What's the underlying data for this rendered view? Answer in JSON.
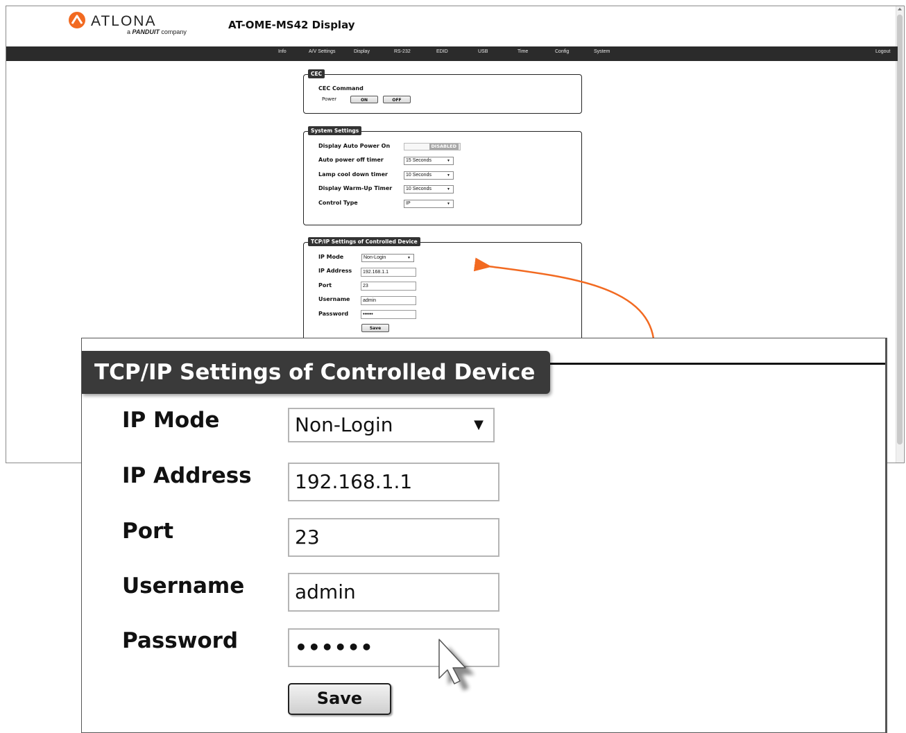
{
  "brand": {
    "name": "ATLONA",
    "tagline_prefix": "a",
    "tagline_brand": "PANDUIT",
    "tagline_suffix": "company"
  },
  "page_title": "AT-OME-MS42  Display",
  "nav": {
    "items": [
      "Info",
      "A/V Settings",
      "Display",
      "RS-232",
      "EDID",
      "USB",
      "Time",
      "Config",
      "System"
    ],
    "logout": "Logout"
  },
  "cec": {
    "legend": "CEC",
    "command_label": "CEC Command",
    "power_label": "Power",
    "on_label": "ON",
    "off_label": "OFF"
  },
  "system_settings": {
    "legend": "System Settings",
    "auto_power_on_label": "Display Auto Power On",
    "auto_power_on_state": "DISABLED",
    "auto_power_off_label": "Auto power off timer",
    "auto_power_off_value": "15 Seconds",
    "lamp_cool_label": "Lamp cool down timer",
    "lamp_cool_value": "10 Seconds",
    "warmup_label": "Display Warm-Up Timer",
    "warmup_value": "10 Seconds",
    "control_type_label": "Control Type",
    "control_type_value": "IP"
  },
  "tcpip": {
    "legend": "TCP/IP Settings of Controlled Device",
    "ip_mode_label": "IP Mode",
    "ip_mode_value": "Non-Login",
    "ip_address_label": "IP Address",
    "ip_address_value": "192.168.1.1",
    "port_label": "Port",
    "port_value": "23",
    "username_label": "Username",
    "username_value": "admin",
    "password_label": "Password",
    "password_value": "••••••",
    "save_label": "Save"
  },
  "colors": {
    "accent": "#f26a21",
    "navbar": "#2b2b2b",
    "legend_bg": "#3a3a3a"
  }
}
